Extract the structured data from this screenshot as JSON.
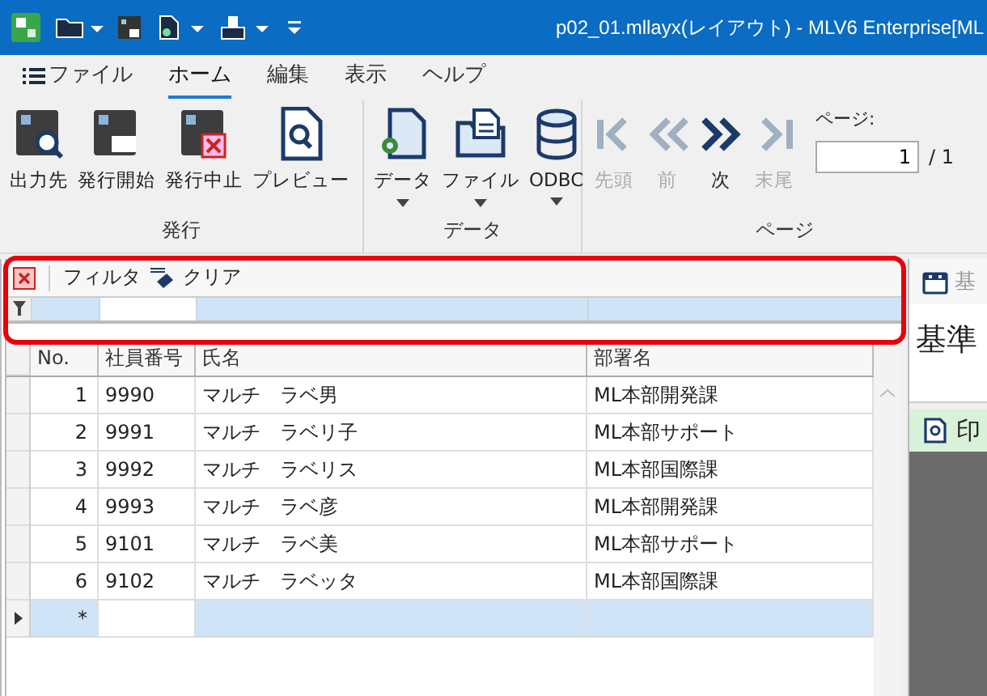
{
  "window": {
    "title": "p02_01.mllayx(レイアウト) - MLV6 Enterprise[ML"
  },
  "menu_tabs": [
    {
      "label": "ファイル",
      "kind": "file",
      "selected": false
    },
    {
      "label": "ホーム",
      "kind": "tab",
      "selected": true
    },
    {
      "label": "編集",
      "kind": "tab",
      "selected": false
    },
    {
      "label": "表示",
      "kind": "tab",
      "selected": false
    },
    {
      "label": "ヘルプ",
      "kind": "tab",
      "selected": false
    }
  ],
  "ribbon": {
    "groups": [
      {
        "label": "発行",
        "buttons": [
          {
            "label": "出力先",
            "kind": "output",
            "dropdown": false,
            "disabled": false
          },
          {
            "label": "発行開始",
            "kind": "start",
            "dropdown": false,
            "disabled": false
          },
          {
            "label": "発行中止",
            "kind": "stop",
            "dropdown": false,
            "disabled": false
          },
          {
            "label": "プレビュー",
            "kind": "preview",
            "dropdown": false,
            "disabled": false
          }
        ]
      },
      {
        "label": "データ",
        "buttons": [
          {
            "label": "データ",
            "kind": "data",
            "dropdown": true,
            "disabled": false
          },
          {
            "label": "ファイル",
            "kind": "file",
            "dropdown": true,
            "disabled": false
          },
          {
            "label": "ODBC",
            "kind": "odbc",
            "dropdown": true,
            "disabled": false
          }
        ]
      },
      {
        "label": "ページ",
        "buttons": [
          {
            "label": "先頭",
            "kind": "first",
            "dropdown": false,
            "disabled": true
          },
          {
            "label": "前",
            "kind": "prev",
            "dropdown": false,
            "disabled": true
          },
          {
            "label": "次",
            "kind": "next",
            "dropdown": false,
            "disabled": false
          },
          {
            "label": "末尾",
            "kind": "last",
            "dropdown": false,
            "disabled": true
          }
        ],
        "page_label": "ページ:",
        "page_value": "1",
        "page_total": "/ 1"
      }
    ]
  },
  "grid": {
    "toolbar": {
      "filter": "フィルタ",
      "clear": "クリア"
    },
    "columns": [
      "No.",
      "社員番号",
      "氏名",
      "部署名"
    ],
    "rows": [
      {
        "cells": [
          "1",
          "9990",
          "マルチ　ラベ男",
          "ML本部開発課"
        ],
        "selected": false
      },
      {
        "cells": [
          "2",
          "9991",
          "マルチ　ラベリ子",
          "ML本部サポート"
        ],
        "selected": false
      },
      {
        "cells": [
          "3",
          "9992",
          "マルチ　ラベリス",
          "ML本部国際課"
        ],
        "selected": false
      },
      {
        "cells": [
          "4",
          "9993",
          "マルチ　ラベ彦",
          "ML本部開発課"
        ],
        "selected": false
      },
      {
        "cells": [
          "5",
          "9101",
          "マルチ　ラベ美",
          "ML本部サポート"
        ],
        "selected": false
      },
      {
        "cells": [
          "6",
          "9102",
          "マルチ　ラベッタ",
          "ML本部国際課"
        ],
        "selected": false
      }
    ],
    "new_row": {
      "marker": "*",
      "selected": true
    }
  },
  "side_panel": {
    "tab_label": "基",
    "heading": "基準",
    "preview_title": "印"
  }
}
